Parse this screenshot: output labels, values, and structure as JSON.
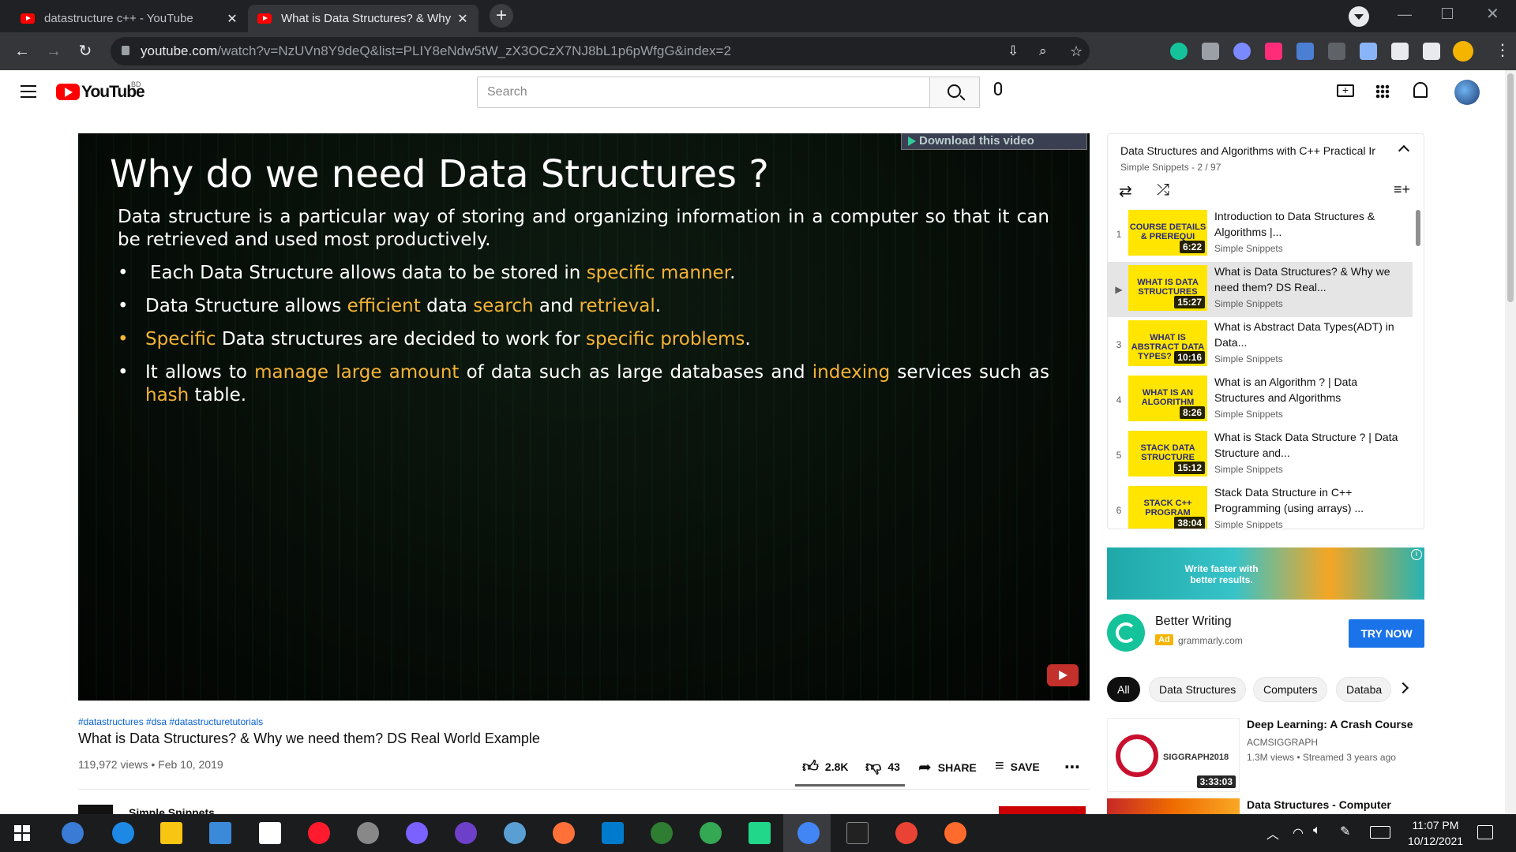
{
  "browser": {
    "tabs": [
      {
        "title": "datastructure c++ - YouTube",
        "active": false
      },
      {
        "title": "What is Data Structures? & Why",
        "active": true
      }
    ],
    "url_host": "youtube.com",
    "url_path": "/watch?v=NzUVn8Y9deQ&list=PLIY8eNdw5tW_zX3OCzX7NJ8bL1p6pWfgG&index=2"
  },
  "youtube": {
    "logo_text": "YouTube",
    "region": "BD",
    "search_placeholder": "Search"
  },
  "video": {
    "download_banner": "Download this video",
    "slide_title": "Why do we need Data Structures ?",
    "slide_intro": "Data structure is a particular way of storing and organizing information in a computer so that it can be retrieved and used most productively.",
    "b1_a": "Each Data Structure allows data to be stored in ",
    "b1_h1": "specific manner",
    "b1_b": ".",
    "b2_a": "Data Structure allows ",
    "b2_h1": "efficient",
    "b2_b": " data ",
    "b2_h2": "search",
    "b2_c": " and ",
    "b2_h3": "retrieval",
    "b2_d": ".",
    "b3_h1": "Specific",
    "b3_a": " Data structures are decided to work for ",
    "b3_h2": "specific problems",
    "b3_b": ".",
    "b4_a": "It allows to ",
    "b4_h1": "manage large amount",
    "b4_b": " of data such as large databases and ",
    "b4_h2": "indexing",
    "b4_c": " services such as ",
    "b4_h3": "hash",
    "b4_d": " table.",
    "hashtags": "#datastructures #dsa #datastructuretutorials",
    "title": "What is Data Structures? & Why we need them? DS Real World Example",
    "meta": "119,972 views • Feb 10, 2019",
    "likes": "2.8K",
    "dislikes": "43",
    "share_label": "SHARE",
    "save_label": "SAVE",
    "channel_partial": "Simple Snippets"
  },
  "playlist": {
    "title": "Data Structures and Algorithms with C++ Practical Ir",
    "subtitle": "Simple Snippets - 2 / 97",
    "items": [
      {
        "index": "1",
        "thumb_text": "COURSE DETAILS & PREREQUI",
        "duration": "6:22",
        "title": "Introduction to Data Structures & Algorithms |...",
        "channel": "Simple Snippets"
      },
      {
        "index": "▶",
        "thumb_text": "WHAT IS DATA STRUCTURES",
        "duration": "15:27",
        "title": "What is Data Structures? & Why we need them? DS Real...",
        "channel": "Simple Snippets"
      },
      {
        "index": "3",
        "thumb_text": "WHAT IS ABSTRACT DATA TYPES? (ADT)",
        "duration": "10:16",
        "title": "What is Abstract Data Types(ADT) in Data...",
        "channel": "Simple Snippets"
      },
      {
        "index": "4",
        "thumb_text": "WHAT IS AN ALGORITHM",
        "duration": "8:26",
        "title": "What is an Algorithm ? | Data Structures and Algorithms",
        "channel": "Simple Snippets"
      },
      {
        "index": "5",
        "thumb_text": "STACK DATA STRUCTURE",
        "duration": "15:12",
        "title": "What is Stack Data Structure ? | Data Structure and...",
        "channel": "Simple Snippets"
      },
      {
        "index": "6",
        "thumb_text": "STACK C++ PROGRAM",
        "duration": "38:04",
        "title": "Stack Data Structure in C++ Programming (using arrays) ...",
        "channel": "Simple Snippets"
      }
    ]
  },
  "ad": {
    "banner_text": "Write faster with better results.",
    "title": "Better Writing",
    "badge": "Ad",
    "domain": "grammarly.com",
    "cta": "TRY NOW"
  },
  "chips": [
    "All",
    "Data Structures",
    "Computers",
    "Databa"
  ],
  "related": [
    {
      "title": "Deep Learning: A Crash Course",
      "channel": "ACMSIGGRAPH",
      "meta": "1.3M views • Streamed 3 years ago",
      "duration": "3:33:03",
      "thumb_text": "SIGGRAPH2018"
    },
    {
      "title": "Data Structures - Computer",
      "channel": "",
      "meta": "",
      "duration": "",
      "thumb_text": ""
    }
  ],
  "taskbar": {
    "time": "11:07 PM",
    "date": "10/12/2021"
  },
  "colors": {
    "youtube_red": "#ff0000",
    "highlight": "#f5b335",
    "cta_blue": "#1a73e8"
  }
}
